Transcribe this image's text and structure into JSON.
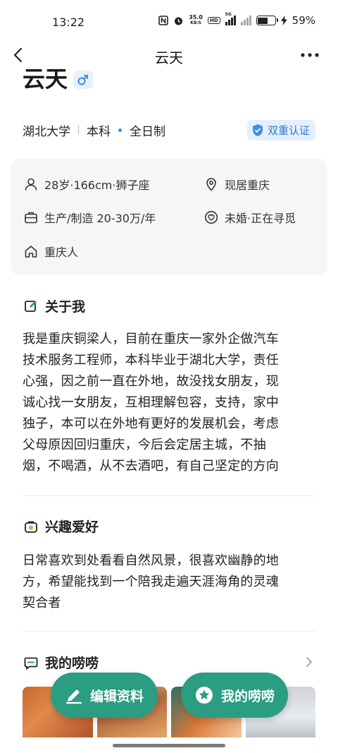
{
  "status_bar": {
    "time": "13:22",
    "speed_value": "35.0",
    "speed_unit": "KB/S",
    "hd_tag": "HD",
    "net_tag": "5G",
    "battery_percent": "59%",
    "battery_level": 0.59
  },
  "nav": {
    "title": "云天",
    "back_icon": "chevron-left-icon",
    "more_icon": "more-dots-icon"
  },
  "profile": {
    "name": "云天",
    "gender_icon": "male-icon",
    "school": "湖北大学",
    "degree": "本科",
    "study_mode": "全日制",
    "verify_label": "双重认证"
  },
  "info": {
    "age_height_sign": "28岁·166cm·狮子座",
    "residence": "现居重庆",
    "job_income": "生产/制造 20-30万/年",
    "marital": "未婚·正在寻觅",
    "hometown": "重庆人"
  },
  "about": {
    "heading": "关于我",
    "lines": [
      "我是重庆铜梁人，目前在重庆一家外企做汽车",
      "技术服务工程师，本科毕业于湖北大学，责任",
      "心强，因之前一直在外地，故没找女朋友，现",
      "诚心找一女朋友，互相理解包容，支持，家中",
      "独子，本可以在外地有更好的发展机会，考虑",
      "父母原因回归重庆，今后会定居主城，不抽",
      "烟，不喝酒，从不去酒吧，有自己坚定的方向"
    ]
  },
  "hobbies": {
    "heading": "兴趣爱好",
    "lines": [
      "日常喜欢到处看看自然风景，很喜欢幽静的地",
      "方，希望能找到一个陪我走遍天涯海角的灵魂",
      "契合者"
    ]
  },
  "posts": {
    "heading": "我的唠唠"
  },
  "actions": {
    "edit_label": "编辑资料",
    "chat_label": "我的唠唠"
  },
  "colors": {
    "accent_green": "#2a9d82",
    "verify_blue": "#2f79cf",
    "card_bg": "#f5f6f8"
  }
}
